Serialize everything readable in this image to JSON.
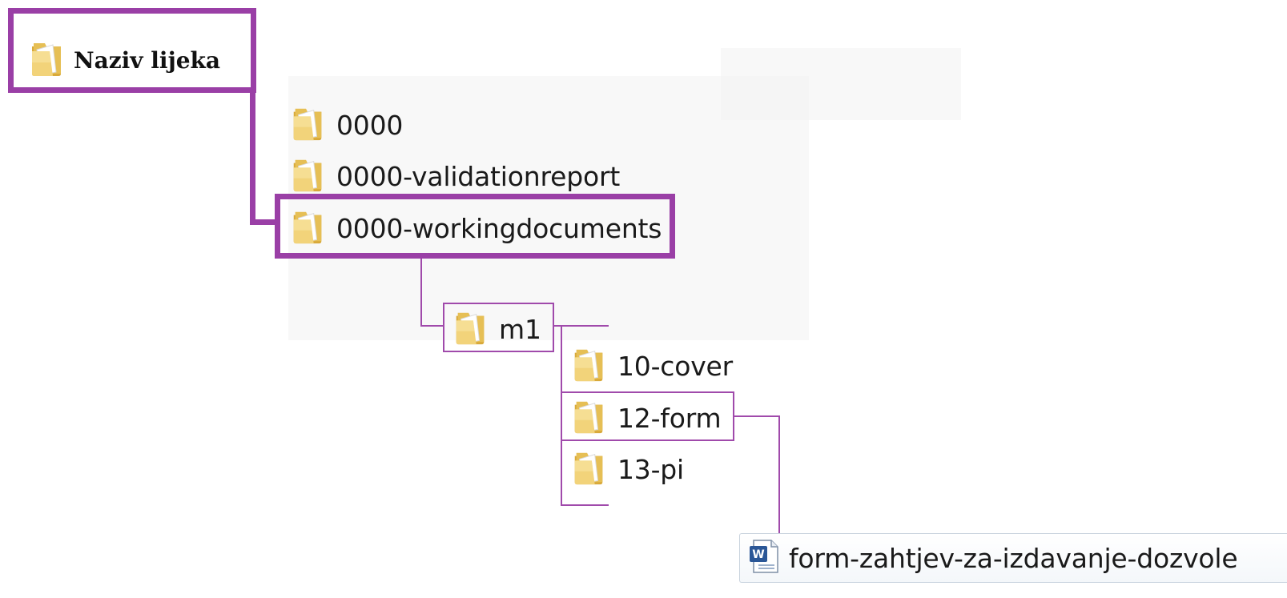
{
  "tree": {
    "root": {
      "label": "Naziv lijeka",
      "icon": "folder-icon"
    },
    "level1": [
      {
        "label": "0000",
        "icon": "folder-icon"
      },
      {
        "label": "0000-validationreport",
        "icon": "folder-icon"
      },
      {
        "label": "0000-workingdocuments",
        "icon": "folder-icon",
        "highlighted": true
      }
    ],
    "level2": [
      {
        "label": "m1",
        "icon": "folder-icon",
        "highlighted": true
      }
    ],
    "level3": [
      {
        "label": "10-cover",
        "icon": "folder-icon"
      },
      {
        "label": "12-form",
        "icon": "folder-icon",
        "highlighted": true
      },
      {
        "label": "13-pi",
        "icon": "folder-icon"
      }
    ],
    "document": {
      "label": "form-zahtjev-za-izdavanje-dozvole",
      "icon": "word-document-icon"
    }
  },
  "colors": {
    "highlight_border": "#9a3fa6",
    "connector": "#a04aab",
    "folder_body": "#f2d37a",
    "folder_shade": "#d8a93a",
    "word_icon": "#2b5797"
  }
}
